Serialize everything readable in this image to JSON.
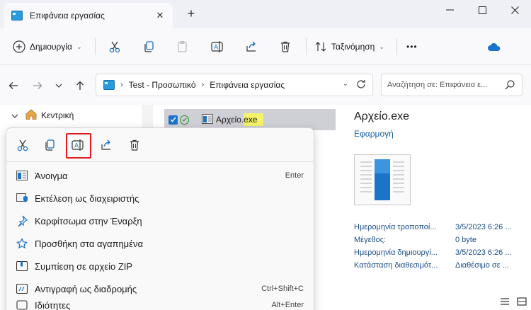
{
  "window": {
    "tab_title": "Επιφάνεια εργασίας",
    "tab_close": "✕",
    "new_tab": "+"
  },
  "commandbar": {
    "new_label": "Δημιουργία",
    "sort_label": "Ταξινόμηση",
    "more": "•••"
  },
  "address": {
    "crumbs": [
      "Test - Προσωπικό",
      "Επιφάνεια εργασίας"
    ],
    "search_placeholder": "Αναζήτηση σε: Επιφάνεια ε..."
  },
  "nav": {
    "home_label": "Κεντρική"
  },
  "file": {
    "name": "Αρχείο.",
    "ext": "exe"
  },
  "details": {
    "title": "Αρχείο.exe",
    "type": "Εφαρμογή",
    "properties": [
      {
        "key": "Ημερομηνία τροποποί...",
        "value": "3/5/2023 6:26 ..."
      },
      {
        "key": "Μέγεθος:",
        "value": "0 byte"
      },
      {
        "key": "Ημερομηνία δημιουργί...",
        "value": "3/5/2023 6:26 ..."
      },
      {
        "key": "Κατάσταση διαθεσιμότ...",
        "value": "Διαθέσιμο σε ..."
      }
    ]
  },
  "context_menu": {
    "items": [
      {
        "label": "Άνοιγμα",
        "shortcut": "Enter",
        "icon": "open-icon"
      },
      {
        "label": "Εκτέλεση ως διαχειριστής",
        "shortcut": "",
        "icon": "shield-icon"
      },
      {
        "label": "Καρφίτσωμα στην Έναρξη",
        "shortcut": "",
        "icon": "pin-icon"
      },
      {
        "label": "Προσθήκη στα αγαπημένα",
        "shortcut": "",
        "icon": "star-icon"
      },
      {
        "label": "Συμπίεση σε αρχείο ZIP",
        "shortcut": "",
        "icon": "zip-icon"
      },
      {
        "label": "Αντιγραφή ως διαδρομής",
        "shortcut": "Ctrl+Shift+C",
        "icon": "copy-path-icon"
      },
      {
        "label": "Ιδιότητες",
        "shortcut": "Alt+Enter",
        "icon": "properties-icon"
      }
    ]
  },
  "colors": {
    "accent": "#1a73c9",
    "highlight_box": "#e01b1b",
    "ext_highlight": "#f4f36a"
  }
}
